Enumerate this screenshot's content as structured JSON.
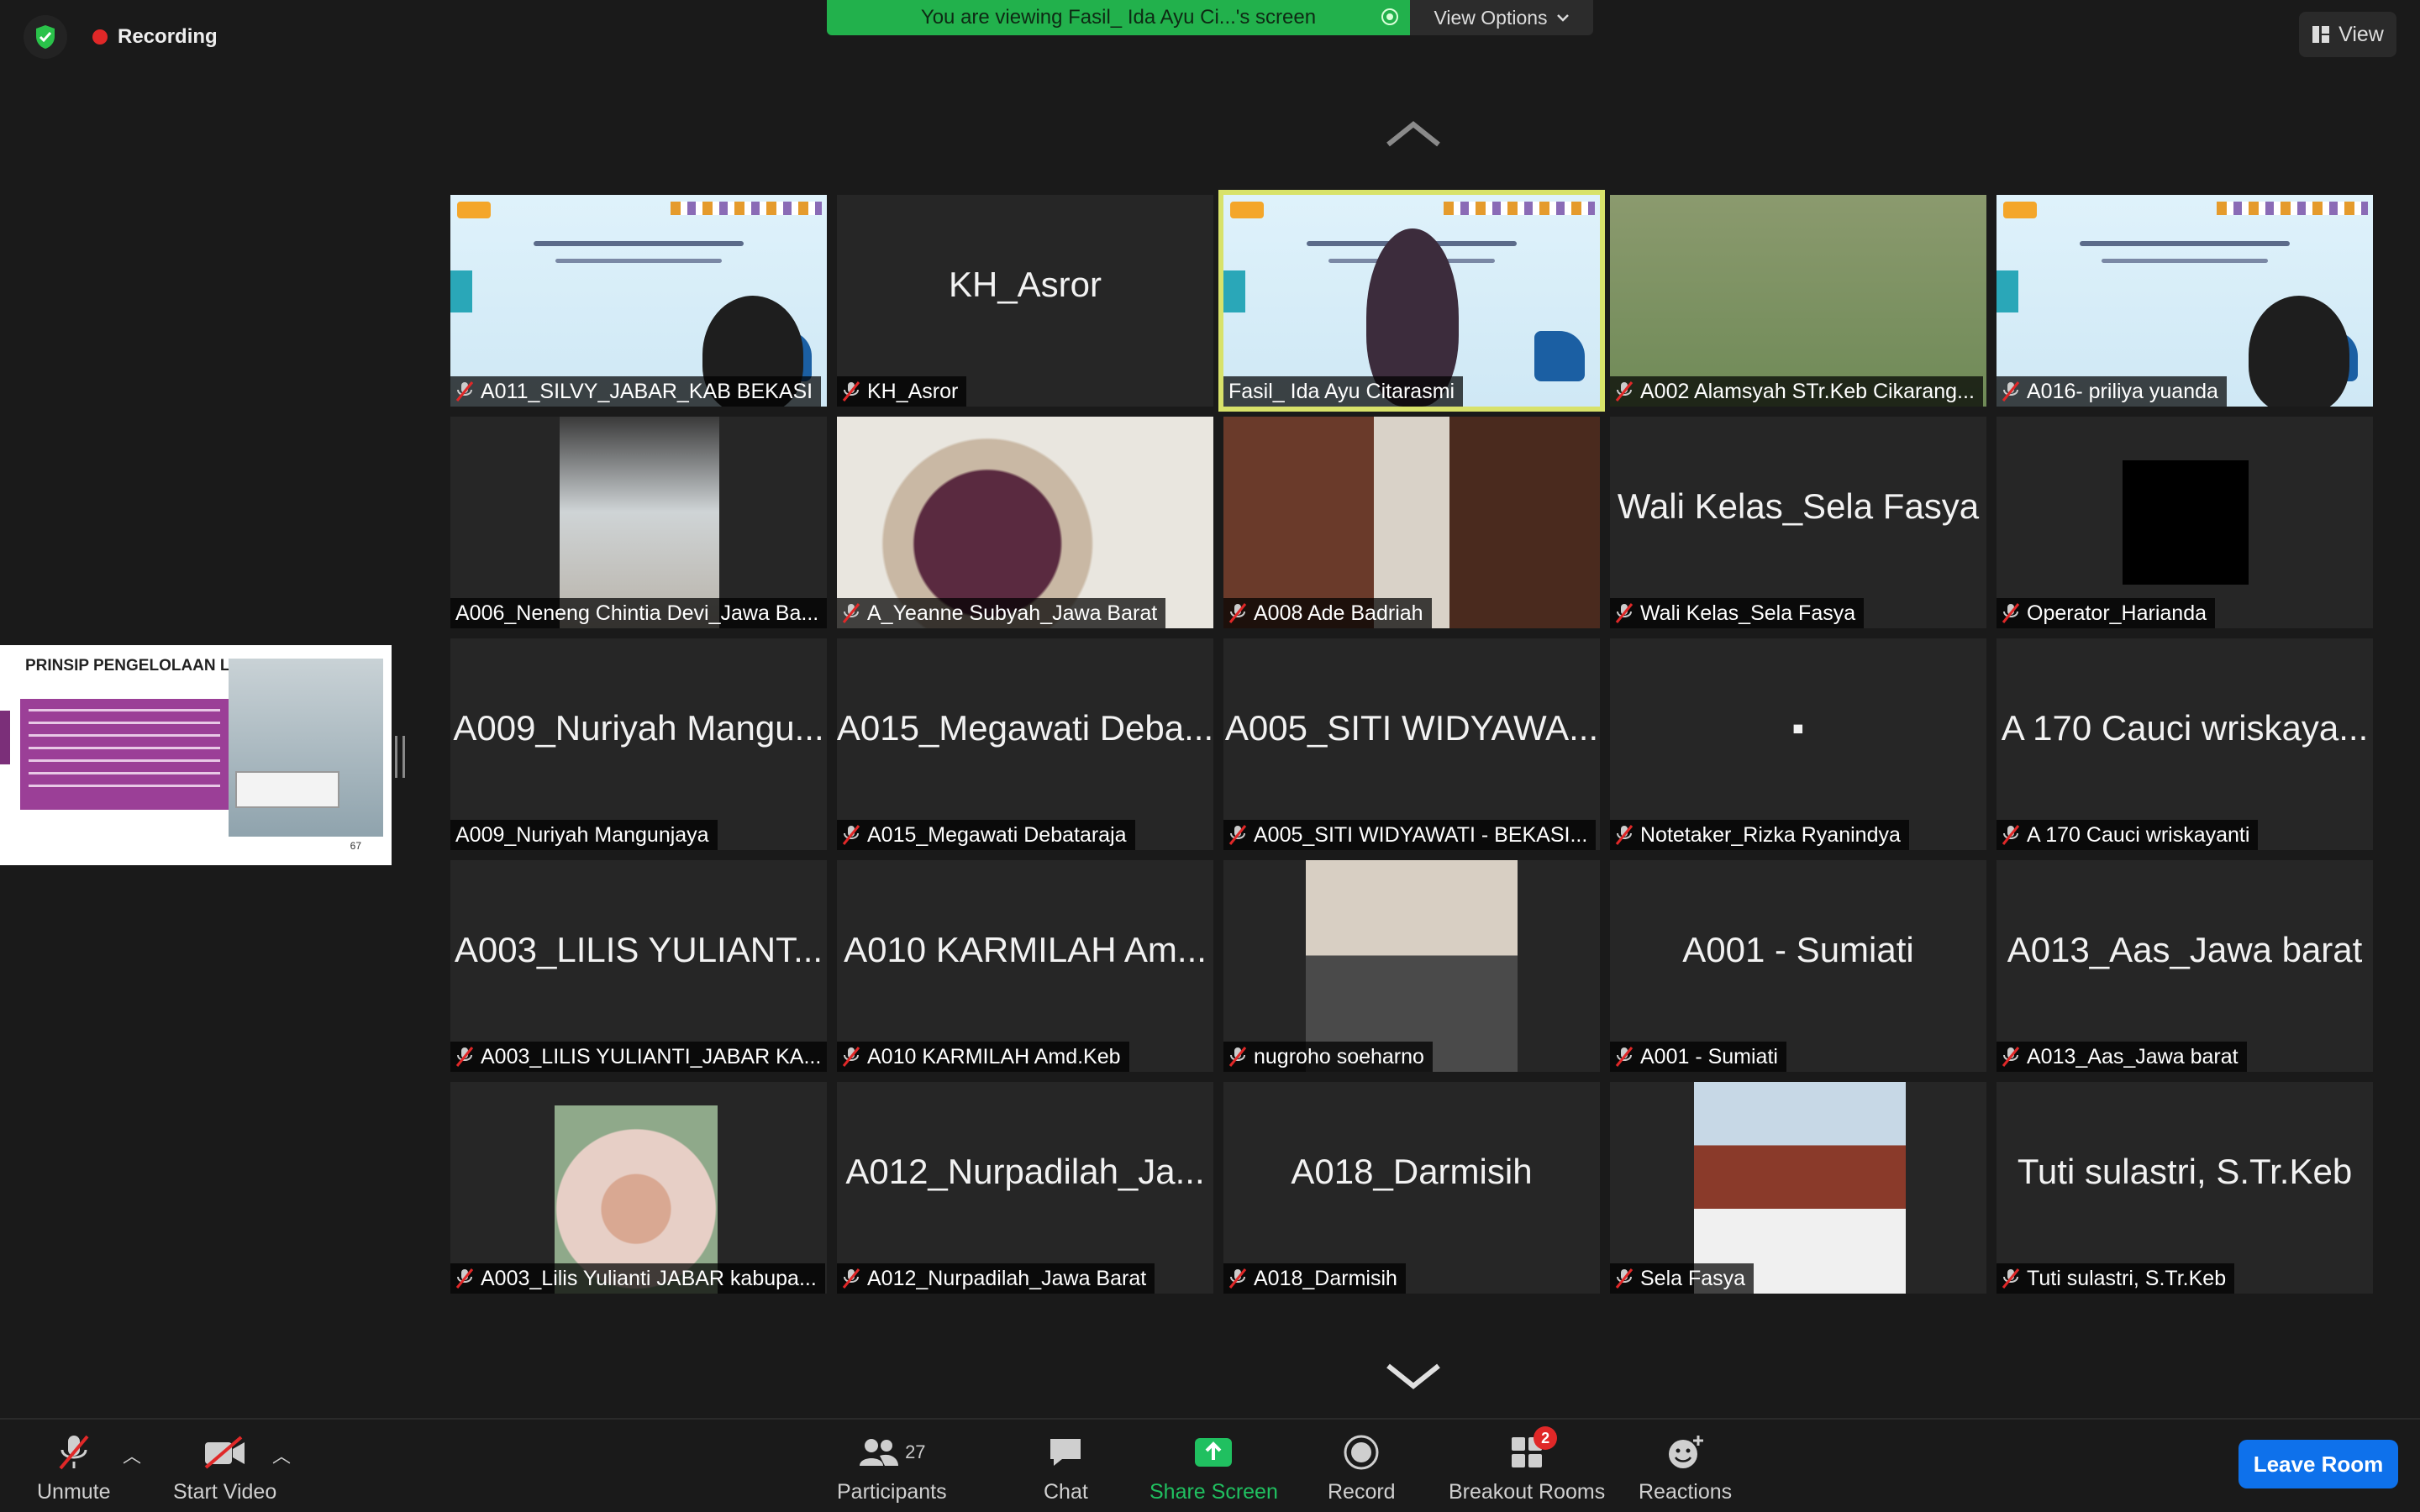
{
  "topbar": {
    "recording_label": "Recording",
    "viewing_banner": "You are viewing Fasil_ Ida Ayu Ci...'s screen",
    "view_options_label": "View Options",
    "view_label": "View"
  },
  "shared_screen": {
    "slide_title": "PRINSIP PENGELOLAAN LINEN",
    "page_number": "67"
  },
  "tiles": [
    {
      "label": "A011_SILVY_JABAR_KAB BEKASI",
      "big": "",
      "video": "slide",
      "muted": true
    },
    {
      "label": "KH_Asror",
      "big": "KH_Asror",
      "video": "none",
      "muted": true
    },
    {
      "label": "Fasil_ Ida Ayu Citarasmi",
      "big": "",
      "video": "slide",
      "muted": false,
      "active": true
    },
    {
      "label": "A002 Alamsyah STr.Keb Cikarang...",
      "big": "",
      "video": "room",
      "muted": true
    },
    {
      "label": "A016- priliya yuanda",
      "big": "",
      "video": "slide",
      "muted": true
    },
    {
      "label": "A006_Neneng Chintia Devi_Jawa Ba...",
      "big": "",
      "video": "car",
      "muted": false
    },
    {
      "label": "A_Yeanne Subyah_Jawa Barat",
      "big": "",
      "video": "face",
      "muted": true
    },
    {
      "label": "A008 Ade Badriah",
      "big": "",
      "video": "door",
      "muted": true
    },
    {
      "label": "Wali Kelas_Sela Fasya",
      "big": "Wali Kelas_Sela Fasya",
      "video": "none",
      "muted": true
    },
    {
      "label": "Operator_Harianda",
      "big": "",
      "video": "black",
      "muted": true
    },
    {
      "label": "A009_Nuriyah Mangunjaya",
      "big": "A009_Nuriyah Mangu...",
      "video": "none",
      "muted": false
    },
    {
      "label": "A015_Megawati Debataraja",
      "big": "A015_Megawati Deba...",
      "video": "none",
      "muted": true
    },
    {
      "label": "A005_SITI WIDYAWATI - BEKASI...",
      "big": "A005_SITI WIDYAWA...",
      "video": "none",
      "muted": true
    },
    {
      "label": "Notetaker_Rizka Ryanindya",
      "big": "▪",
      "video": "none",
      "muted": true
    },
    {
      "label": "A 170 Cauci wriskayanti",
      "big": "A 170 Cauci wriskaya...",
      "video": "none",
      "muted": true
    },
    {
      "label": "A003_LILIS YULIANTI_JABAR KA...",
      "big": "A003_LILIS YULIANT...",
      "video": "none",
      "muted": true
    },
    {
      "label": "A010 KARMILAH Amd.Keb",
      "big": "A010 KARMILAH Am...",
      "video": "none",
      "muted": true
    },
    {
      "label": "nugroho soeharno",
      "big": "",
      "video": "man",
      "muted": true
    },
    {
      "label": "A001 - Sumiati",
      "big": "A001 - Sumiati",
      "video": "none",
      "muted": true
    },
    {
      "label": "A013_Aas_Jawa barat",
      "big": "A013_Aas_Jawa barat",
      "video": "none",
      "muted": true
    },
    {
      "label": "A003_Lilis Yulianti JABAR kabupa...",
      "big": "",
      "video": "hijab",
      "muted": true
    },
    {
      "label": "A012_Nurpadilah_Jawa Barat",
      "big": "A012_Nurpadilah_Ja...",
      "video": "none",
      "muted": true
    },
    {
      "label": "A018_Darmisih",
      "big": "A018_Darmisih",
      "video": "none",
      "muted": true
    },
    {
      "label": "Sela Fasya",
      "big": "",
      "video": "temple",
      "muted": true
    },
    {
      "label": "Tuti sulastri, S.Tr.Keb",
      "big": "Tuti sulastri, S.Tr.Keb",
      "video": "none",
      "muted": true
    }
  ],
  "toolbar": {
    "unmute": "Unmute",
    "start_video": "Start Video",
    "participants": "Participants",
    "participants_count": "27",
    "chat": "Chat",
    "share_screen": "Share Screen",
    "record": "Record",
    "breakout_rooms": "Breakout Rooms",
    "breakout_badge": "2",
    "reactions": "Reactions",
    "leave_room": "Leave Room"
  },
  "colors": {
    "banner_green": "#22b14c",
    "active_border": "#d8e26a",
    "leave_blue": "#0e71eb",
    "share_green": "#20c060",
    "record_red": "#e02828"
  }
}
